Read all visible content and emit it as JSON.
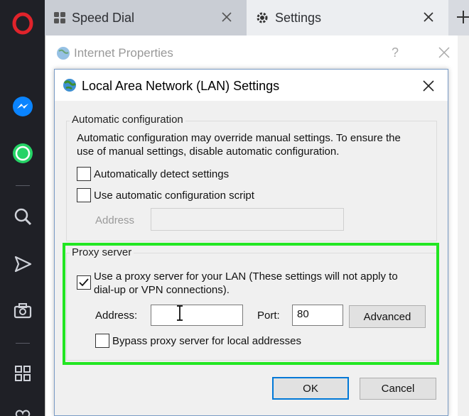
{
  "browser": {
    "tabs": [
      {
        "label": "Speed Dial"
      },
      {
        "label": "Settings"
      }
    ]
  },
  "internet_properties": {
    "title": "Internet Properties",
    "help": "?"
  },
  "lan": {
    "title": "Local Area Network (LAN) Settings",
    "auto": {
      "legend": "Automatic configuration",
      "description_line1": "Automatic configuration may override manual settings.  To ensure the",
      "description_line2": "use of manual settings, disable automatic configuration.",
      "detect_label": "Automatically detect settings",
      "detect_checked": false,
      "script_label": "Use automatic configuration script",
      "script_checked": false,
      "address_label": "Address",
      "address_value": ""
    },
    "proxy": {
      "legend": "Proxy server",
      "use_proxy_line1": "Use a proxy server for your LAN (These settings will not apply to",
      "use_proxy_line2": "dial-up or VPN connections).",
      "use_proxy_checked": true,
      "address_label": "Address:",
      "address_value": "",
      "port_label": "Port:",
      "port_value": "80",
      "advanced_label": "Advanced",
      "bypass_label": "Bypass proxy server for local addresses",
      "bypass_checked": false
    },
    "ok_label": "OK",
    "cancel_label": "Cancel"
  },
  "colors": {
    "highlight": "#22e622",
    "opera_red": "#e0232b",
    "messenger_blue": "#0a84ff",
    "whatsapp_green": "#25d366"
  }
}
